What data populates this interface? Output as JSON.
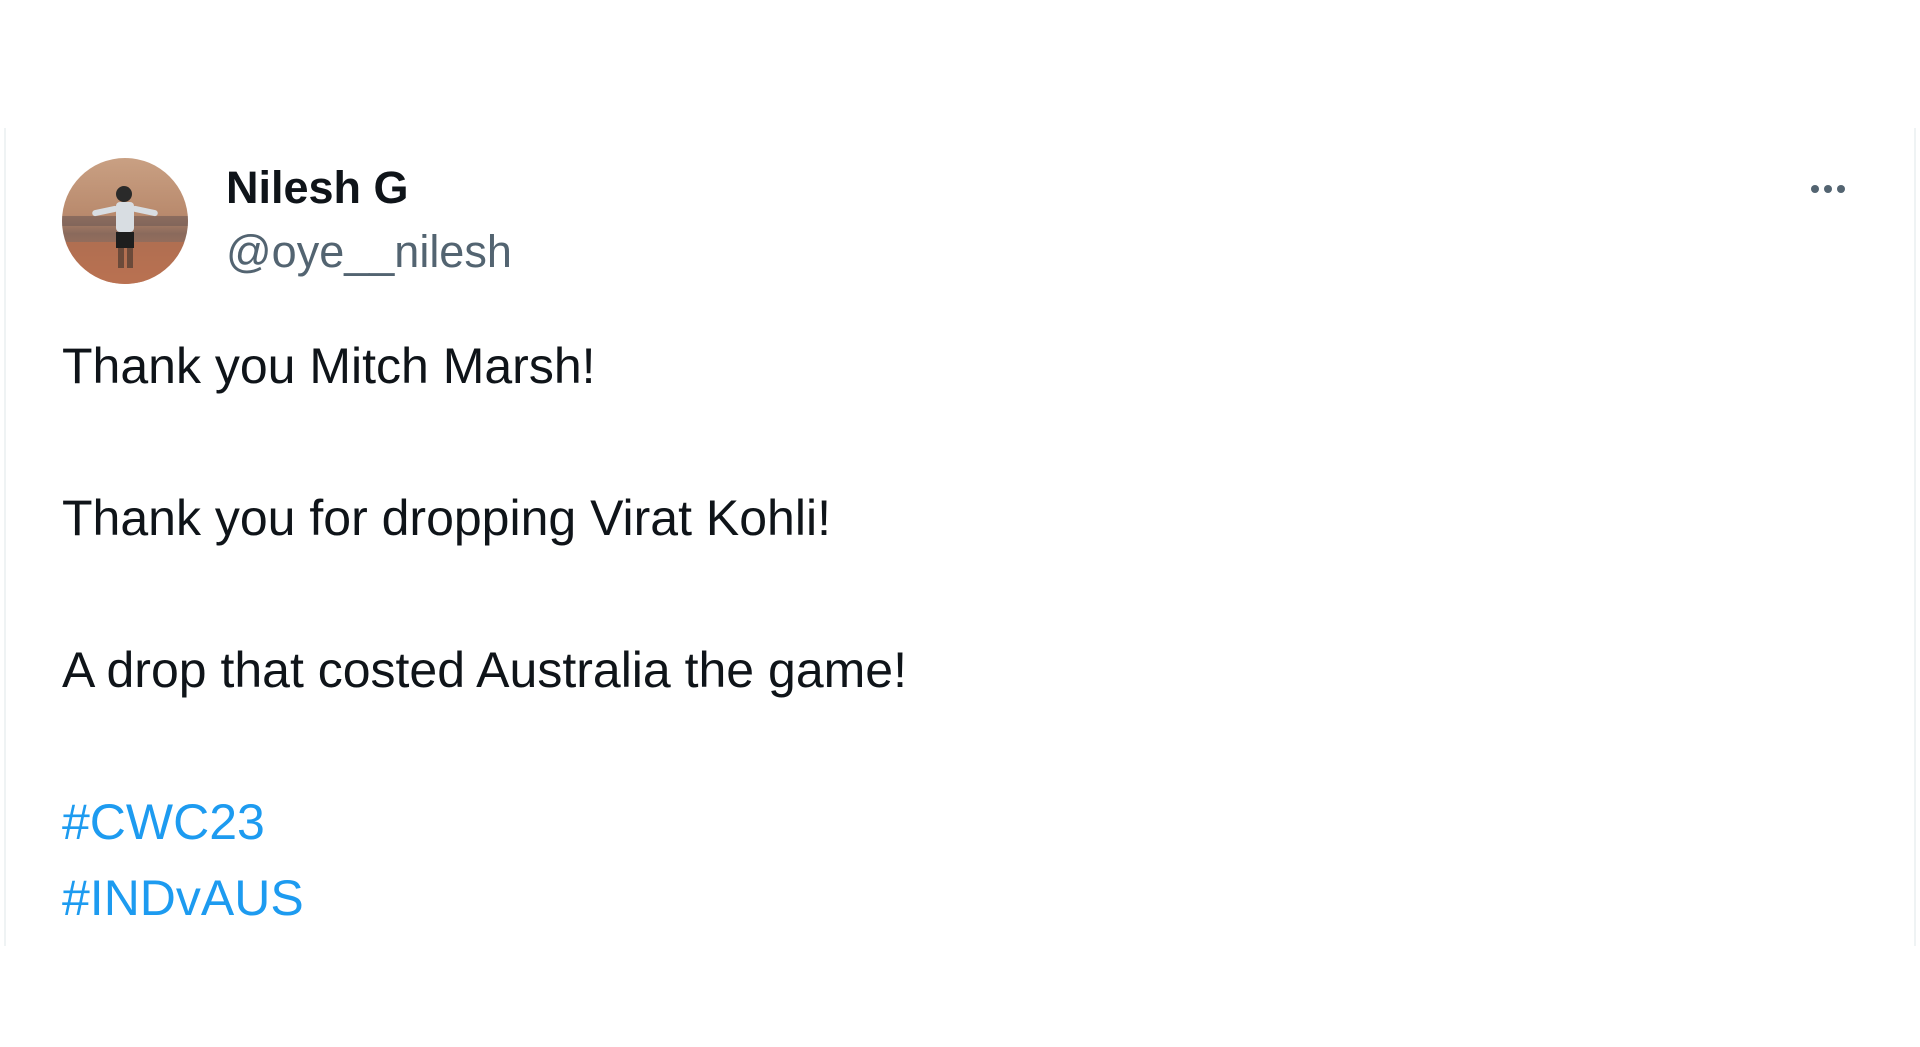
{
  "tweet": {
    "author": {
      "display_name": "Nilesh G",
      "handle": "@oye__nilesh",
      "avatar_icon": "profile-photo-avatar"
    },
    "more_icon": "more-options-icon",
    "lines": [
      "Thank you Mitch Marsh!",
      "Thank you for dropping Virat Kohli!",
      "A drop that costed Australia the game!"
    ],
    "hashtags": [
      "#CWC23",
      "#INDvAUS"
    ]
  },
  "colors": {
    "text_primary": "#0f1419",
    "text_secondary": "#536471",
    "link": "#1d9bf0",
    "border": "#eff3f4"
  }
}
